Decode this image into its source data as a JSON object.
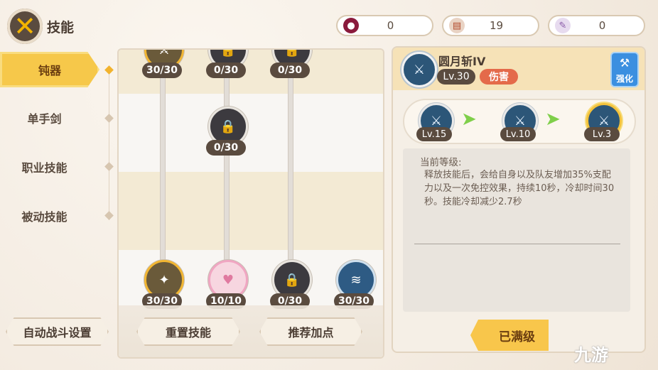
{
  "header": {
    "title": "技能"
  },
  "currencies": [
    {
      "icon": "gem-icon",
      "value": "0"
    },
    {
      "icon": "book-icon",
      "value": "19"
    },
    {
      "icon": "scroll-icon",
      "value": "0"
    }
  ],
  "tabs": [
    {
      "label": "钝器",
      "active": true
    },
    {
      "label": "单手剑",
      "active": false
    },
    {
      "label": "职业技能",
      "active": false
    },
    {
      "label": "被动技能",
      "active": false
    }
  ],
  "tree": {
    "top_counts": [
      "30/30",
      "0/30",
      "0/30"
    ],
    "mid_count": "0/30",
    "bottom_counts": [
      "30/30",
      "10/10",
      "0/30",
      "30/30"
    ]
  },
  "buttons": {
    "auto_battle": "自动战斗设置",
    "reset": "重置技能",
    "recommend": "推荐加点",
    "maxed": "已满级"
  },
  "detail": {
    "name": "圆月斩IV",
    "level": "Lv.30",
    "type_tag": "伤害",
    "enhance": "强化",
    "chain": [
      "Lv.15",
      "Lv.10",
      "Lv.3"
    ],
    "current_label": "当前等级:",
    "description": "释放技能后，会给自身以及队友增加35%支配力以及一次免控效果，持续10秒，冷却时间30秒。技能冷却减少2.7秒"
  },
  "watermark": "九游",
  "colors": {
    "accent": "#f6c84a",
    "panel": "#f5efe6",
    "damage": "#e46a4a"
  }
}
